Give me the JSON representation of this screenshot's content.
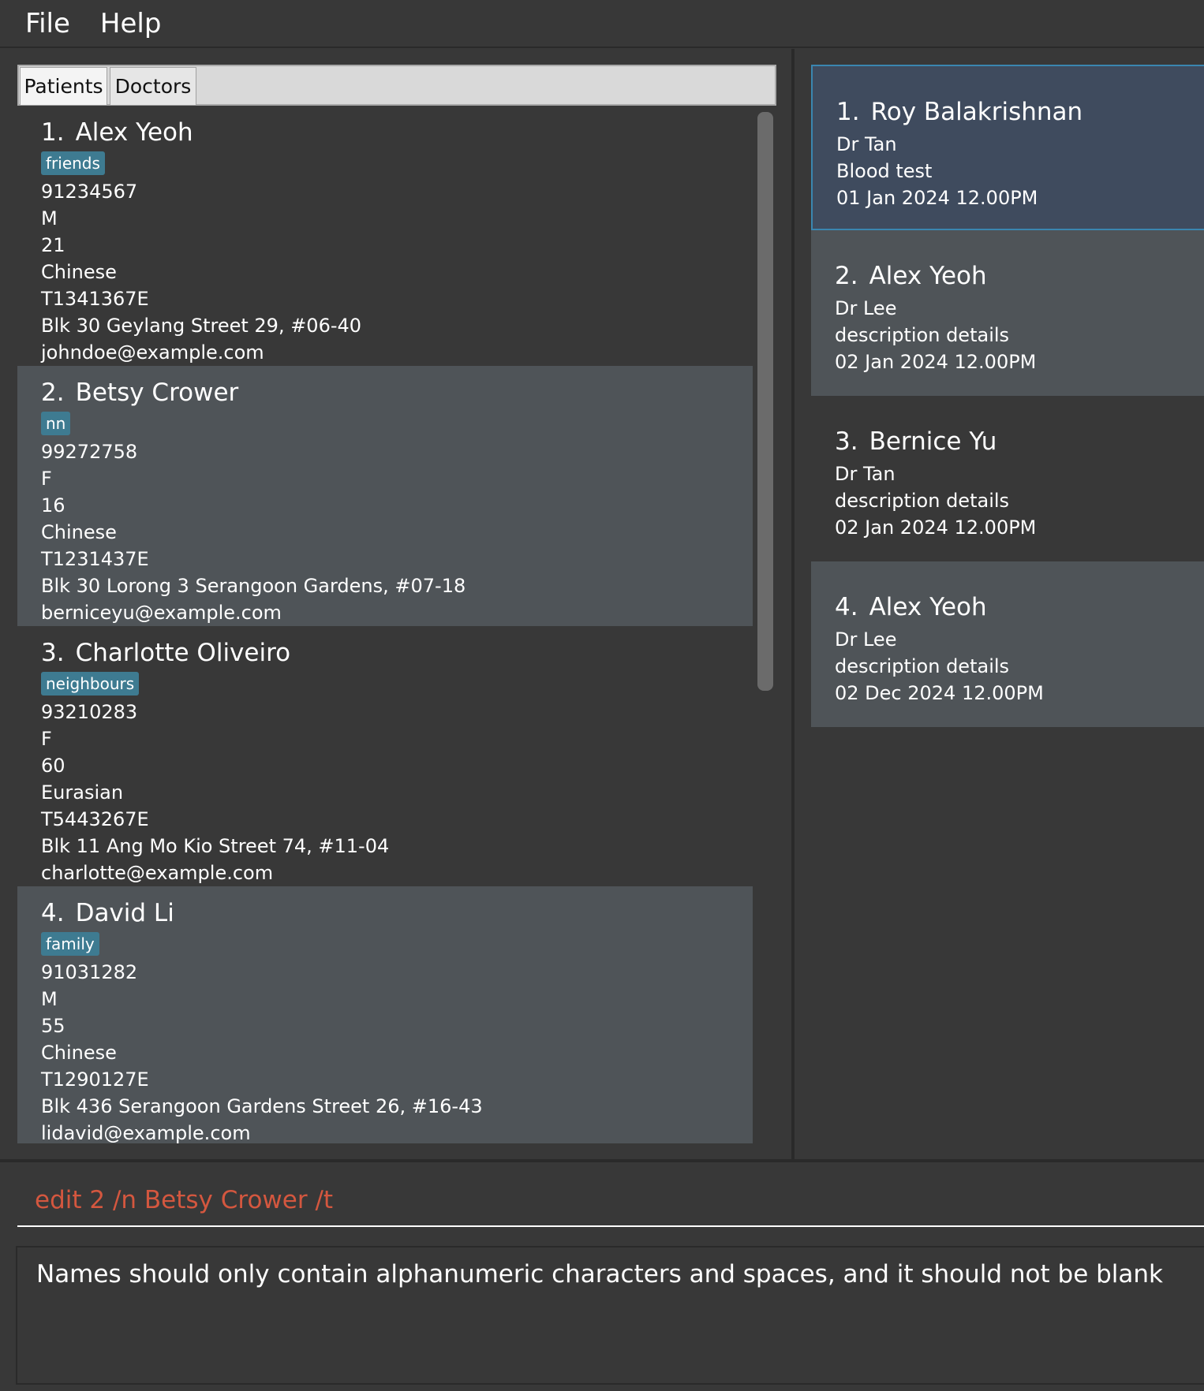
{
  "menu": {
    "file": "File",
    "help": "Help"
  },
  "tabs": {
    "patients": "Patients",
    "doctors": "Doctors"
  },
  "patients": [
    {
      "index": "1.",
      "name": "Alex Yeoh",
      "tag": "friends",
      "phone": "91234567",
      "sex": "M",
      "age": "21",
      "race": "Chinese",
      "nric": "T1341367E",
      "address": "Blk 30 Geylang Street 29, #06-40",
      "email": "johndoe@example.com"
    },
    {
      "index": "2.",
      "name": "Betsy Crower",
      "tag": "nn",
      "phone": "99272758",
      "sex": "F",
      "age": "16",
      "race": "Chinese",
      "nric": "T1231437E",
      "address": "Blk 30 Lorong 3 Serangoon Gardens, #07-18",
      "email": "berniceyu@example.com"
    },
    {
      "index": "3.",
      "name": "Charlotte Oliveiro",
      "tag": "neighbours",
      "phone": "93210283",
      "sex": "F",
      "age": "60",
      "race": "Eurasian",
      "nric": "T5443267E",
      "address": "Blk 11 Ang Mo Kio Street 74, #11-04",
      "email": "charlotte@example.com"
    },
    {
      "index": "4.",
      "name": "David Li",
      "tag": "family",
      "phone": "91031282",
      "sex": "M",
      "age": "55",
      "race": "Chinese",
      "nric": "T1290127E",
      "address": "Blk 436 Serangoon Gardens Street 26, #16-43",
      "email": "lidavid@example.com"
    }
  ],
  "appointments": [
    {
      "index": "1.",
      "patient": "Roy Balakrishnan",
      "doctor": "Dr Tan",
      "description": "Blood test",
      "datetime": "01 Jan 2024 12.00PM"
    },
    {
      "index": "2.",
      "patient": "Alex Yeoh",
      "doctor": "Dr Lee",
      "description": "description details",
      "datetime": "02 Jan 2024 12.00PM"
    },
    {
      "index": "3.",
      "patient": "Bernice Yu",
      "doctor": "Dr Tan",
      "description": "description details",
      "datetime": "02 Jan 2024 12.00PM"
    },
    {
      "index": "4.",
      "patient": "Alex Yeoh",
      "doctor": "Dr Lee",
      "description": "description details",
      "datetime": "02 Dec 2024 12.00PM"
    }
  ],
  "command": {
    "value": "edit 2 /n Betsy Crower /t"
  },
  "result": {
    "message": "Names should only contain alphanumeric characters and spaces, and it should not be blank"
  },
  "colors": {
    "background": "#383838",
    "card_alt": "#4f5458",
    "tag": "#3e7b91",
    "selected": "#3f4b5e",
    "command_error": "#d4573f"
  }
}
